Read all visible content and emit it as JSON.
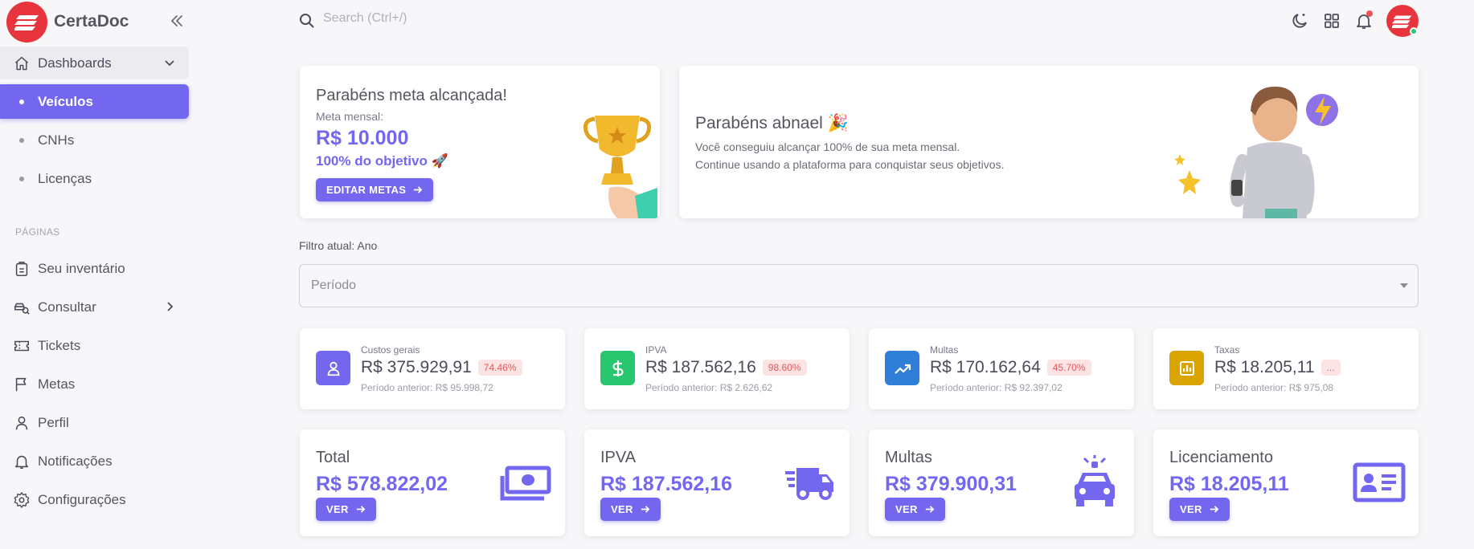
{
  "brand": {
    "name": "CertaDoc",
    "accent": "#7367f0",
    "logo_color": "#e8343c"
  },
  "sidebar": {
    "group": {
      "label": "Dashboards",
      "icon": "home-icon"
    },
    "sub_items": [
      {
        "label": "Veículos",
        "active": true
      },
      {
        "label": "CNHs",
        "active": false
      },
      {
        "label": "Licenças",
        "active": false
      }
    ],
    "section_title": "PÁGINAS",
    "links": [
      {
        "label": "Seu inventário",
        "icon": "inventory-icon"
      },
      {
        "label": "Consultar",
        "icon": "search-car-icon"
      },
      {
        "label": "Tickets",
        "icon": "ticket-icon"
      },
      {
        "label": "Metas",
        "icon": "flag-icon"
      },
      {
        "label": "Perfil",
        "icon": "user-icon"
      },
      {
        "label": "Notificações",
        "icon": "bell-icon"
      },
      {
        "label": "Configurações",
        "icon": "gear-icon"
      }
    ]
  },
  "topbar": {
    "search_placeholder": "Search (Ctrl+/)"
  },
  "congrats": {
    "title": "Parabéns meta alcançada!",
    "subtitle": "Meta mensal:",
    "amount": "R$ 10.000",
    "goal": "100% do objetivo 🚀",
    "button": "EDITAR METAS"
  },
  "welcome": {
    "title": "Parabéns abnael 🎉",
    "line1": "Você conseguiu alcançar 100% de sua meta mensal.",
    "line2": "Continue usando a plataforma para conquistar seus objetivos."
  },
  "filter": {
    "label": "Filtro atual: Ano",
    "select_value": "Período"
  },
  "stats": [
    {
      "label": "Custos gerais",
      "value": "R$ 375.929,91",
      "badge": "74.46%",
      "prev": "Período anterior: R$ 95.998,72",
      "icon": "user-icon",
      "color": "#7367f0"
    },
    {
      "label": "IPVA",
      "value": "R$ 187.562,16",
      "badge": "98.60%",
      "prev": "Período anterior: R$ 2.626,62",
      "icon": "dollar-icon",
      "color": "#28c76f"
    },
    {
      "label": "Multas",
      "value": "R$ 170.162,64",
      "badge": "45.70%",
      "prev": "Período anterior: R$ 92.397,02",
      "icon": "trending-up-icon",
      "color": "#2f7ed8"
    },
    {
      "label": "Taxas",
      "value": "R$ 18.205,11",
      "badge": "...",
      "prev": "Período anterior: R$ 975,08",
      "icon": "chart-icon",
      "color": "#d9a400"
    }
  ],
  "totals": [
    {
      "label": "Total",
      "value": "R$ 578.822,02",
      "button": "VER",
      "icon": "money-icon"
    },
    {
      "label": "IPVA",
      "value": "R$ 187.562,16",
      "button": "VER",
      "icon": "truck-icon"
    },
    {
      "label": "Multas",
      "value": "R$ 379.900,31",
      "button": "VER",
      "icon": "police-car-icon"
    },
    {
      "label": "Licenciamento",
      "value": "R$ 18.205,11",
      "button": "VER",
      "icon": "id-card-icon"
    }
  ]
}
